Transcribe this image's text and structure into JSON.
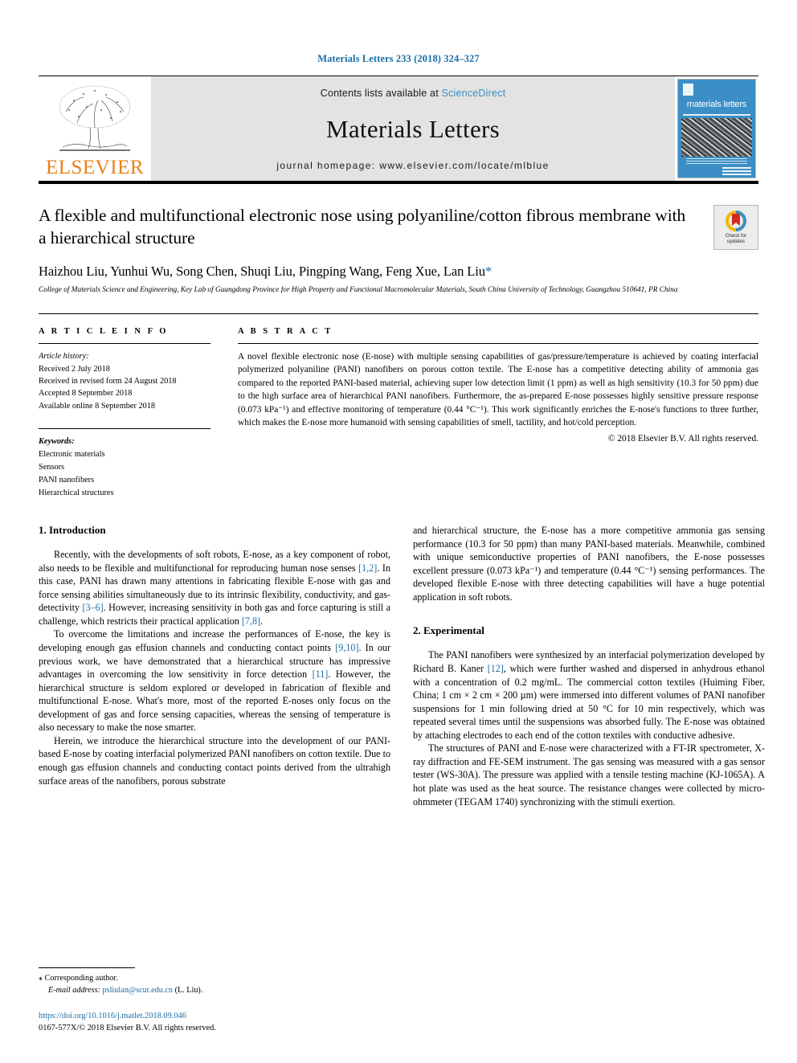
{
  "running_head": "Materials Letters 233 (2018) 324–327",
  "masthead": {
    "publisher_name": "ELSEVIER",
    "contents_prefix": "Contents lists available at",
    "contents_link": "ScienceDirect",
    "journal_title": "Materials Letters",
    "homepage_line": "journal homepage: www.elsevier.com/locate/mlblue",
    "cover_title": "materials letters",
    "link_color": "#3a8fc4",
    "elsevier_orange": "#ec8016",
    "cover_blue": "#3b8fc6"
  },
  "article": {
    "title": "A flexible and multifunctional electronic nose using polyaniline/cotton fibrous membrane with a hierarchical structure",
    "authors": "Haizhou Liu, Yunhui Wu, Song Chen, Shuqi Liu, Pingping Wang, Feng Xue, Lan Liu",
    "corresponding_marker": "*",
    "affiliation": "College of Materials Science and Engineering, Key Lab of Guangdong Province for High Property and Functional Macromolecular Materials, South China University of Technology, Guangzhou 510641, PR China",
    "crossmark_line1": "Check for",
    "crossmark_line2": "updates"
  },
  "article_info": {
    "heading": "A R T I C L E  I N F O",
    "history_label": "Article history:",
    "history": [
      "Received 2 July 2018",
      "Received in revised form 24 August 2018",
      "Accepted 8 September 2018",
      "Available online 8 September 2018"
    ],
    "keywords_label": "Keywords:",
    "keywords": [
      "Electronic materials",
      "Sensors",
      "PANI nanofibers",
      "Hierarchical structures"
    ]
  },
  "abstract": {
    "heading": "A B S T R A C T",
    "text": "A novel flexible electronic nose (E-nose) with multiple sensing capabilities of gas/pressure/temperature is achieved by coating interfacial polymerized polyaniline (PANI) nanofibers on porous cotton textile. The E-nose has a competitive detecting ability of ammonia gas compared to the reported PANI-based material, achieving super low detection limit (1 ppm) as well as high sensitivity (10.3 for 50 ppm) due to the high surface area of hierarchical PANI nanofibers. Furthermore, the as-prepared E-nose possesses highly sensitive pressure response (0.073 kPa⁻¹) and effective monitoring of temperature (0.44 °C⁻¹). This work significantly enriches the E-nose's functions to three further, which makes the E-nose more humanoid with sensing capabilities of smell, tactility, and hot/cold perception.",
    "copyright": "© 2018 Elsevier B.V. All rights reserved."
  },
  "sections": {
    "intro_heading": "1. Introduction",
    "intro_p1_a": "Recently, with the developments of soft robots, E-nose, as a key component of robot, also needs to be flexible and multifunctional for reproducing human nose senses ",
    "intro_p1_ref1": "[1,2]",
    "intro_p1_b": ". In this case, PANI has drawn many attentions in fabricating flexible E-nose with gas and force sensing abilities simultaneously due to its intrinsic flexibility, conductivity, and gas-detectivity ",
    "intro_p1_ref2": "[3–6]",
    "intro_p1_c": ". However, increasing sensitivity in both gas and force capturing is still a challenge, which restricts their practical application ",
    "intro_p1_ref3": "[7,8]",
    "intro_p1_d": ".",
    "intro_p2_a": "To overcome the limitations and increase the performances of E-nose, the key is developing enough gas effusion channels and conducting contact points ",
    "intro_p2_ref1": "[9,10]",
    "intro_p2_b": ". In our previous work, we have demonstrated that a hierarchical structure has impressive advantages in overcoming the low sensitivity in force detection ",
    "intro_p2_ref2": "[11]",
    "intro_p2_c": ". However, the hierarchical structure is seldom explored or developed in fabrication of flexible and multifunctional E-nose. What's more, most of the reported E-noses only focus on the development of gas and force sensing capacities, whereas the sensing of temperature is also necessary to make the nose smarter.",
    "intro_p3": "Herein, we introduce the hierarchical structure into the development of our PANI-based E-nose by coating interfacial polymerized PANI nanofibers on cotton textile. Due to enough gas effusion channels and conducting contact points derived from the ultrahigh surface areas of the nanofibers, porous substrate",
    "intro_p4": "and hierarchical structure, the E-nose has a more competitive ammonia gas sensing performance (10.3 for 50 ppm) than many PANI-based materials. Meanwhile, combined with unique semiconductive properties of PANI nanofibers, the E-nose possesses excellent pressure (0.073 kPa⁻¹) and temperature (0.44 °C⁻¹) sensing performances. The developed flexible E-nose with three detecting capabilities will have a huge potential application in soft robots.",
    "exp_heading": "2. Experimental",
    "exp_p1_a": "The PANI nanofibers were synthesized by an interfacial polymerization developed by Richard B. Kaner ",
    "exp_p1_ref": "[12]",
    "exp_p1_b": ", which were further washed and dispersed in anhydrous ethanol with a concentration of 0.2 mg/mL. The commercial cotton textiles (Huiming Fiber, China; 1 cm × 2 cm × 200 µm) were immersed into different volumes of PANI nanofiber suspensions for 1 min following dried at 50 °C for 10 min respectively, which was repeated several times until the suspensions was absorbed fully. The E-nose was obtained by attaching electrodes to each end of the cotton textiles with conductive adhesive.",
    "exp_p2": "The structures of PANI and E-nose were characterized with a FT-IR spectrometer, X-ray diffraction and FE-SEM instrument. The gas sensing was measured with a gas sensor tester (WS-30A). The pressure was applied with a tensile testing machine (KJ-1065A). A hot plate was used as the heat source. The resistance changes were collected by micro-ohmmeter (TEGAM 1740) synchronizing with the stimuli exertion."
  },
  "footnote": {
    "corresponding": "⁎ Corresponding author.",
    "email_label": "E-mail address:",
    "email": "psliulan@scut.edu.cn",
    "email_suffix": "(L. Liu).",
    "doi": "https://doi.org/10.1016/j.matlet.2018.09.046",
    "issn": "0167-577X/© 2018 Elsevier B.V. All rights reserved."
  }
}
